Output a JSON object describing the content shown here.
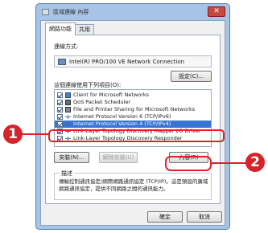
{
  "window": {
    "title": "區域連線 內容",
    "close_glyph": "✕"
  },
  "tabs": [
    {
      "label": "網路功能",
      "active": true
    },
    {
      "label": "共用",
      "active": false
    }
  ],
  "connect_using": {
    "label": "連線方式:",
    "adapter_name": "Intel(R) PRO/100 VE Network Connection",
    "configure_button": "設定(C)..."
  },
  "items_label": "這個連線使用下列項目(O):",
  "items": [
    {
      "label": "Client for Microsoft Networks",
      "checked": true,
      "icon": "client-icon"
    },
    {
      "label": "QoS Packet Scheduler",
      "checked": true,
      "icon": "scheduler-icon"
    },
    {
      "label": "File and Printer Sharing for Microsoft Networks",
      "checked": true,
      "icon": "sharing-icon"
    },
    {
      "label": "Internet Protocol Version 6 (TCP/IPv6)",
      "checked": true,
      "icon": "protocol-icon"
    },
    {
      "label": "Internet Protocol Version 4 (TCP/IPv4)",
      "checked": true,
      "icon": "protocol-icon",
      "selected": true
    },
    {
      "label": "Link-Layer Topology Discovery Mapper I/O Driver",
      "checked": true,
      "icon": "protocol-icon"
    },
    {
      "label": "Link-Layer Topology Discovery Responder",
      "checked": true,
      "icon": "protocol-icon"
    }
  ],
  "buttons": {
    "install": "安裝(N)...",
    "uninstall": "解除安裝(U)",
    "properties": "內容(R)"
  },
  "description": {
    "legend": "描述",
    "text": "傳輸控制通訊協定/網際網路通訊協定 (TCP/IP)。這是預設的廣域網路通訊協定，提供不同網路之間的通訊能力。"
  },
  "footer": {
    "ok": "確定",
    "cancel": "取消"
  },
  "callouts": {
    "one": "1",
    "two": "2"
  },
  "colors": {
    "callout": "#d7232b",
    "selection": "#3874d2"
  }
}
